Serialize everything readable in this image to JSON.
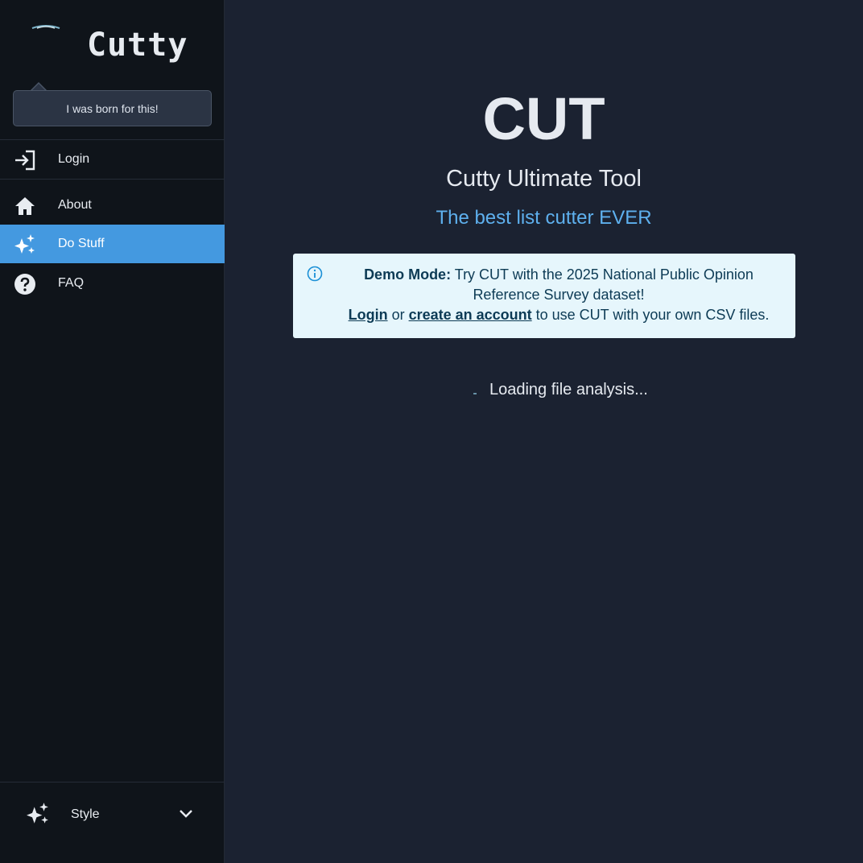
{
  "sidebar": {
    "logo_text": "Cutty",
    "bubble_text": "I was born for this!",
    "items": [
      {
        "label": "Login",
        "icon": "login-icon"
      },
      {
        "label": "About",
        "icon": "home-icon"
      },
      {
        "label": "Do Stuff",
        "icon": "sparkles-icon",
        "active": true
      },
      {
        "label": "FAQ",
        "icon": "question-circle-icon"
      }
    ],
    "style": {
      "label": "Style",
      "icon": "sparkles-icon",
      "chevron": "chevron-down-icon"
    }
  },
  "main": {
    "title": "CUT",
    "subtitle": "Cutty Ultimate Tool",
    "tagline": "The best list cutter EVER",
    "alert": {
      "icon": "info-icon",
      "bold": "Demo Mode:",
      "line1": " Try CUT with the 2025 National Public Opinion Reference Survey dataset!",
      "login_link": "Login",
      "or_text": " or ",
      "signup_link": "create an account",
      "line2_rest": " to use CUT with your own CSV files."
    },
    "loading_text": "Loading file analysis..."
  },
  "colors": {
    "sidebar_bg": "#0f141a",
    "main_bg": "#1b2231",
    "accent": "#4499e0",
    "tagline": "#5eb0ee",
    "alert_bg": "#e6f6fc"
  }
}
